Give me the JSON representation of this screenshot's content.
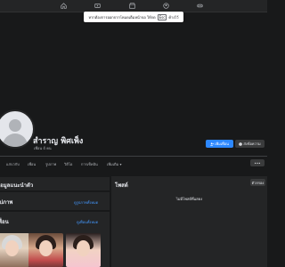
{
  "nav": {
    "icons": [
      "home-icon",
      "video-icon",
      "marketplace-icon",
      "groups-icon",
      "gaming-icon"
    ]
  },
  "toast": {
    "text": "หากต้องการออกจากโหมดเต็มหน้าจอ ให้กด",
    "key": "Esc",
    "suffix": "ค้างไว้"
  },
  "profile": {
    "name": "สำราญ พิศเพ็ง",
    "friends": "เพื่อน 4 คน",
    "add_friend": "เพิ่มเพื่อน",
    "message": "ส่งข้อความ"
  },
  "tabs": {
    "items": [
      "แก่บวกับ",
      "เพื่อน",
      "รูปภาพ",
      "วิดีโอ",
      "การเช็คอิน",
      "เพิ่มเติม ▾"
    ],
    "more": "•••"
  },
  "intro": {
    "title": "ข้อมูลแนะนำตัว"
  },
  "photos": {
    "title": "รูปภาพ",
    "link": "ดูรูปภาพทั้งหมด"
  },
  "friends": {
    "title": "เพื่อน",
    "link": "ดูเพื่อนทั้งหมด"
  },
  "posts": {
    "title": "โพสต์",
    "filter": "ตัวกรอง",
    "empty": "ไม่มีโพสต์ที่แสดง"
  }
}
